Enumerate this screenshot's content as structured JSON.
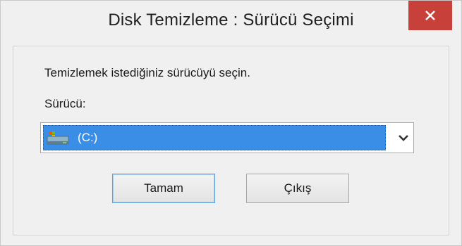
{
  "window": {
    "title": "Disk Temizleme : Sürücü Seçimi",
    "close_icon": "close-icon"
  },
  "dialog": {
    "instruction": "Temizlemek istediğiniz sürücüyü seçin.",
    "drive_label": "Sürücü:",
    "drive_select": {
      "selected_value": "(C:)",
      "icon": "drive-icon"
    },
    "ok_button": "Tamam",
    "exit_button": "Çıkış"
  },
  "colors": {
    "close_red": "#c7413a",
    "selection_blue": "#3a8ee6",
    "window_bg": "#f0f0f0"
  }
}
